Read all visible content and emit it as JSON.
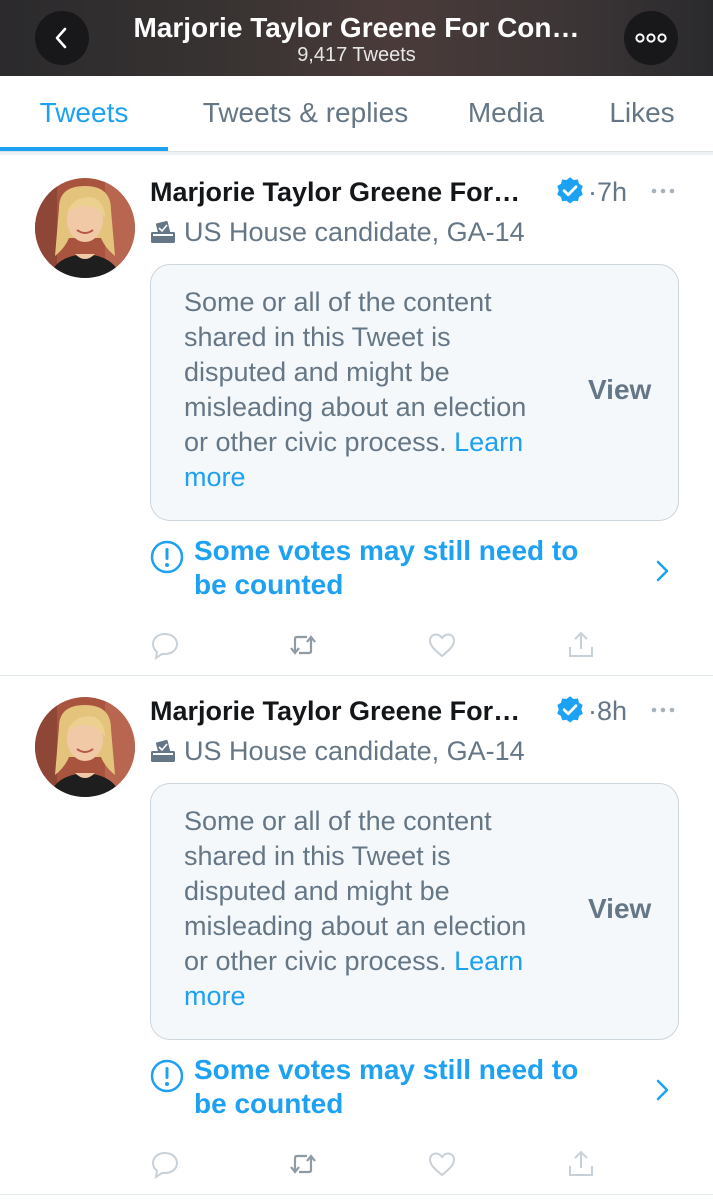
{
  "header": {
    "title": "Marjorie Taylor Greene For Con…",
    "subtitle": "9,417 Tweets",
    "back_icon": "chevron-left-icon",
    "more_icon": "more-horizontal-icon"
  },
  "tabs": [
    {
      "label": "Tweets",
      "active": true
    },
    {
      "label": "Tweets & replies",
      "active": false
    },
    {
      "label": "Media",
      "active": false
    },
    {
      "label": "Likes",
      "active": false
    }
  ],
  "colors": {
    "accent": "#1da1f2",
    "secondary_text": "#657786",
    "notice_bg": "#f5f8fa"
  },
  "tweets": [
    {
      "name": "Marjorie Taylor Greene For…",
      "verified": true,
      "time": "7h",
      "label": "US House candidate, GA-14",
      "notice_text": "Some or all of the content shared in this Tweet is disputed and might be misleading about an election or other civic process.",
      "learn_more": "Learn more",
      "view_label": "View",
      "warning": "Some votes may still need to be counted"
    },
    {
      "name": "Marjorie Taylor Greene For…",
      "verified": true,
      "time": "8h",
      "label": "US House candidate, GA-14",
      "notice_text": "Some or all of the content shared in this Tweet is disputed and might be misleading about an election or other civic process.",
      "learn_more": "Learn more",
      "view_label": "View",
      "warning": "Some votes may still need to be counted"
    }
  ]
}
